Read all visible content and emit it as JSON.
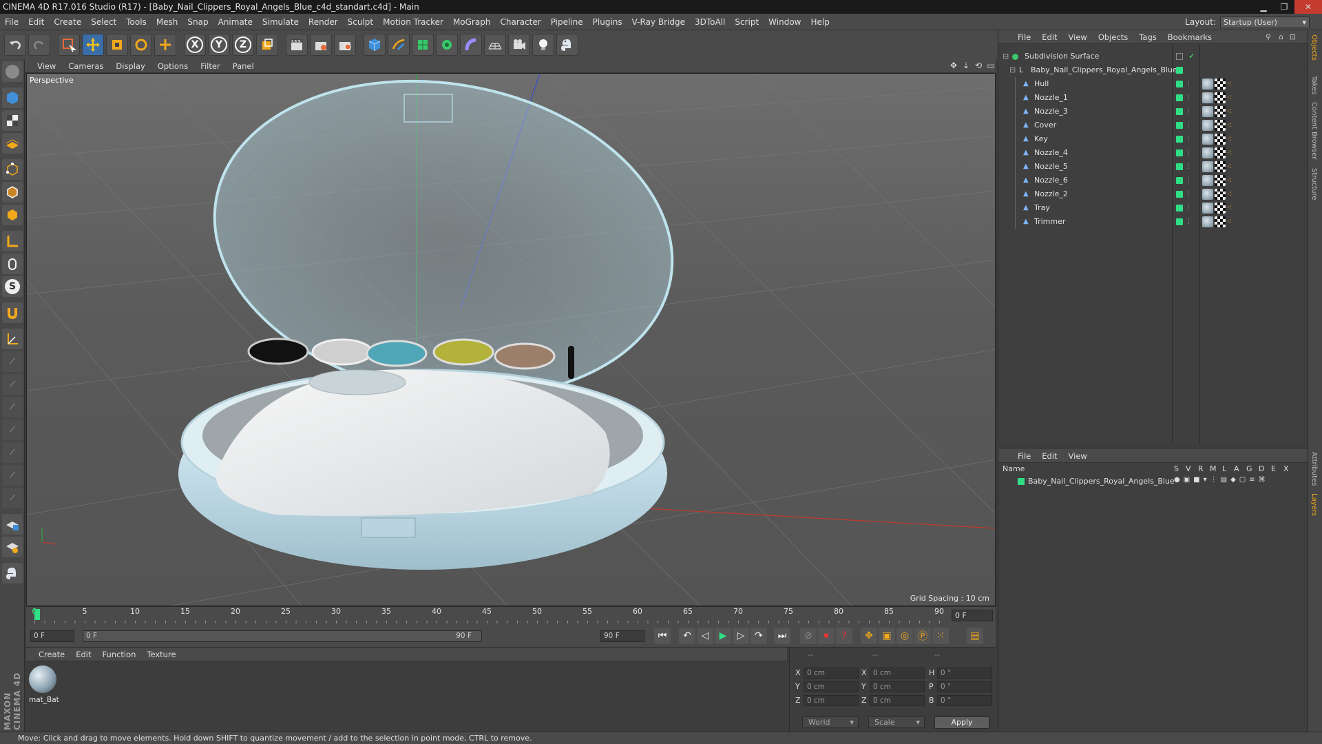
{
  "window": {
    "title": "CINEMA 4D R17.016 Studio (R17) - [Baby_Nail_Clippers_Royal_Angels_Blue_c4d_standart.c4d] - Main",
    "minimize": "▁",
    "maximize": "❐",
    "close": "✕"
  },
  "menu": [
    "File",
    "Edit",
    "Create",
    "Select",
    "Tools",
    "Mesh",
    "Snap",
    "Animate",
    "Simulate",
    "Render",
    "Sculpt",
    "Motion Tracker",
    "MoGraph",
    "Character",
    "Pipeline",
    "Plugins",
    "V-Ray Bridge",
    "3DToAll",
    "Script",
    "Window",
    "Help"
  ],
  "layout": {
    "label": "Layout:",
    "value": "Startup (User)"
  },
  "toolbar": {
    "axis_x": "X",
    "axis_y": "Y",
    "axis_z": "Z"
  },
  "viewport": {
    "menu": [
      "View",
      "Cameras",
      "Display",
      "Options",
      "Filter",
      "Panel"
    ],
    "camera_label": "Perspective",
    "grid_spacing": "Grid Spacing : 10 cm"
  },
  "timeline": {
    "ticks": [
      "0",
      "5",
      "10",
      "15",
      "20",
      "25",
      "30",
      "35",
      "40",
      "45",
      "50",
      "55",
      "60",
      "65",
      "70",
      "75",
      "80",
      "85",
      "90"
    ],
    "current_frame": "0 F"
  },
  "transport": {
    "start_field": "0 F",
    "range_start": "0 F",
    "range_end": "90 F",
    "end_field": "90 F"
  },
  "material_panel": {
    "menu": [
      "Create",
      "Edit",
      "Function",
      "Texture"
    ],
    "material_name": "mat_Bat"
  },
  "maxon_logo": "MAXON CINEMA 4D",
  "coords": {
    "header": [
      "--",
      "--",
      "--"
    ],
    "rows": [
      {
        "a": "X",
        "av": "0 cm",
        "b": "X",
        "bv": "0 cm",
        "c": "H",
        "cv": "0 °"
      },
      {
        "a": "Y",
        "av": "0 cm",
        "b": "Y",
        "bv": "0 cm",
        "c": "P",
        "cv": "0 °"
      },
      {
        "a": "Z",
        "av": "0 cm",
        "b": "Z",
        "bv": "0 cm",
        "c": "B",
        "cv": "0 °"
      }
    ],
    "world": "World",
    "scale": "Scale",
    "apply": "Apply"
  },
  "status": "Move: Click and drag to move elements. Hold down SHIFT to quantize movement / add to the selection in point mode, CTRL to remove.",
  "object_manager": {
    "menu": [
      "File",
      "Edit",
      "View",
      "Objects",
      "Tags",
      "Bookmarks"
    ],
    "root": "Subdivision Surface",
    "group": "Baby_Nail_Clippers_Royal_Angels_Blue",
    "children": [
      "Hull",
      "Nozzle_1",
      "Nozzle_3",
      "Cover",
      "Key",
      "Nozzle_4",
      "Nozzle_5",
      "Nozzle_6",
      "Nozzle_2",
      "Tray",
      "Trimmer"
    ]
  },
  "layer_manager": {
    "menu": [
      "File",
      "Edit",
      "View"
    ],
    "columns": [
      "Name",
      "S",
      "V",
      "R",
      "M",
      "L",
      "A",
      "G",
      "D",
      "E",
      "X"
    ],
    "layer": "Baby_Nail_Clippers_Royal_Angels_Blue"
  },
  "right_tabs": [
    "Objects",
    "Takes",
    "Content Browser",
    "Structure",
    "Attributes",
    "Layers"
  ],
  "colors": {
    "accent_green": "#2fdf85",
    "object_blue": "#cfe6ef",
    "close_red": "#c63b30"
  }
}
